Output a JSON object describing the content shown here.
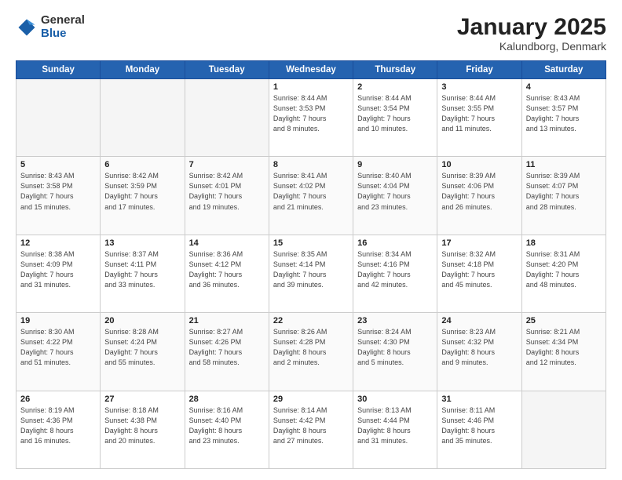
{
  "logo": {
    "general": "General",
    "blue": "Blue"
  },
  "header": {
    "title": "January 2025",
    "location": "Kalundborg, Denmark"
  },
  "weekdays": [
    "Sunday",
    "Monday",
    "Tuesday",
    "Wednesday",
    "Thursday",
    "Friday",
    "Saturday"
  ],
  "weeks": [
    [
      {
        "day": "",
        "info": ""
      },
      {
        "day": "",
        "info": ""
      },
      {
        "day": "",
        "info": ""
      },
      {
        "day": "1",
        "info": "Sunrise: 8:44 AM\nSunset: 3:53 PM\nDaylight: 7 hours\nand 8 minutes."
      },
      {
        "day": "2",
        "info": "Sunrise: 8:44 AM\nSunset: 3:54 PM\nDaylight: 7 hours\nand 10 minutes."
      },
      {
        "day": "3",
        "info": "Sunrise: 8:44 AM\nSunset: 3:55 PM\nDaylight: 7 hours\nand 11 minutes."
      },
      {
        "day": "4",
        "info": "Sunrise: 8:43 AM\nSunset: 3:57 PM\nDaylight: 7 hours\nand 13 minutes."
      }
    ],
    [
      {
        "day": "5",
        "info": "Sunrise: 8:43 AM\nSunset: 3:58 PM\nDaylight: 7 hours\nand 15 minutes."
      },
      {
        "day": "6",
        "info": "Sunrise: 8:42 AM\nSunset: 3:59 PM\nDaylight: 7 hours\nand 17 minutes."
      },
      {
        "day": "7",
        "info": "Sunrise: 8:42 AM\nSunset: 4:01 PM\nDaylight: 7 hours\nand 19 minutes."
      },
      {
        "day": "8",
        "info": "Sunrise: 8:41 AM\nSunset: 4:02 PM\nDaylight: 7 hours\nand 21 minutes."
      },
      {
        "day": "9",
        "info": "Sunrise: 8:40 AM\nSunset: 4:04 PM\nDaylight: 7 hours\nand 23 minutes."
      },
      {
        "day": "10",
        "info": "Sunrise: 8:39 AM\nSunset: 4:06 PM\nDaylight: 7 hours\nand 26 minutes."
      },
      {
        "day": "11",
        "info": "Sunrise: 8:39 AM\nSunset: 4:07 PM\nDaylight: 7 hours\nand 28 minutes."
      }
    ],
    [
      {
        "day": "12",
        "info": "Sunrise: 8:38 AM\nSunset: 4:09 PM\nDaylight: 7 hours\nand 31 minutes."
      },
      {
        "day": "13",
        "info": "Sunrise: 8:37 AM\nSunset: 4:11 PM\nDaylight: 7 hours\nand 33 minutes."
      },
      {
        "day": "14",
        "info": "Sunrise: 8:36 AM\nSunset: 4:12 PM\nDaylight: 7 hours\nand 36 minutes."
      },
      {
        "day": "15",
        "info": "Sunrise: 8:35 AM\nSunset: 4:14 PM\nDaylight: 7 hours\nand 39 minutes."
      },
      {
        "day": "16",
        "info": "Sunrise: 8:34 AM\nSunset: 4:16 PM\nDaylight: 7 hours\nand 42 minutes."
      },
      {
        "day": "17",
        "info": "Sunrise: 8:32 AM\nSunset: 4:18 PM\nDaylight: 7 hours\nand 45 minutes."
      },
      {
        "day": "18",
        "info": "Sunrise: 8:31 AM\nSunset: 4:20 PM\nDaylight: 7 hours\nand 48 minutes."
      }
    ],
    [
      {
        "day": "19",
        "info": "Sunrise: 8:30 AM\nSunset: 4:22 PM\nDaylight: 7 hours\nand 51 minutes."
      },
      {
        "day": "20",
        "info": "Sunrise: 8:28 AM\nSunset: 4:24 PM\nDaylight: 7 hours\nand 55 minutes."
      },
      {
        "day": "21",
        "info": "Sunrise: 8:27 AM\nSunset: 4:26 PM\nDaylight: 7 hours\nand 58 minutes."
      },
      {
        "day": "22",
        "info": "Sunrise: 8:26 AM\nSunset: 4:28 PM\nDaylight: 8 hours\nand 2 minutes."
      },
      {
        "day": "23",
        "info": "Sunrise: 8:24 AM\nSunset: 4:30 PM\nDaylight: 8 hours\nand 5 minutes."
      },
      {
        "day": "24",
        "info": "Sunrise: 8:23 AM\nSunset: 4:32 PM\nDaylight: 8 hours\nand 9 minutes."
      },
      {
        "day": "25",
        "info": "Sunrise: 8:21 AM\nSunset: 4:34 PM\nDaylight: 8 hours\nand 12 minutes."
      }
    ],
    [
      {
        "day": "26",
        "info": "Sunrise: 8:19 AM\nSunset: 4:36 PM\nDaylight: 8 hours\nand 16 minutes."
      },
      {
        "day": "27",
        "info": "Sunrise: 8:18 AM\nSunset: 4:38 PM\nDaylight: 8 hours\nand 20 minutes."
      },
      {
        "day": "28",
        "info": "Sunrise: 8:16 AM\nSunset: 4:40 PM\nDaylight: 8 hours\nand 23 minutes."
      },
      {
        "day": "29",
        "info": "Sunrise: 8:14 AM\nSunset: 4:42 PM\nDaylight: 8 hours\nand 27 minutes."
      },
      {
        "day": "30",
        "info": "Sunrise: 8:13 AM\nSunset: 4:44 PM\nDaylight: 8 hours\nand 31 minutes."
      },
      {
        "day": "31",
        "info": "Sunrise: 8:11 AM\nSunset: 4:46 PM\nDaylight: 8 hours\nand 35 minutes."
      },
      {
        "day": "",
        "info": ""
      }
    ]
  ]
}
